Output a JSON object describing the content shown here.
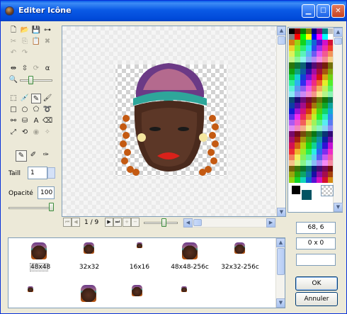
{
  "window": {
    "title": "Editer Icône",
    "controls": {
      "minimize": "▁",
      "maximize": "☐",
      "close": "✕"
    }
  },
  "tools": {
    "size_label": "Taill",
    "size_value": "1",
    "opacity_label": "Opacité",
    "opacity_value": "100",
    "opacity_level": 1.0
  },
  "canvas": {
    "page_indicator": "1 / 9",
    "zoom_level": 0.6
  },
  "info": {
    "coords": "68, 6",
    "selection": "0 x 0",
    "extra": ""
  },
  "formats": {
    "row1": [
      {
        "label": "48x48",
        "selected": true
      },
      {
        "label": "32x32",
        "selected": false
      },
      {
        "label": "16x16",
        "selected": false
      },
      {
        "label": "48x48-256c",
        "selected": false
      },
      {
        "label": "32x32-256c",
        "selected": false
      }
    ]
  },
  "buttons": {
    "ok": "OK",
    "cancel": "Annuler"
  },
  "colors": {
    "titlebar": "#0a5ae6",
    "foreground": "#000000",
    "background": "#005363"
  }
}
